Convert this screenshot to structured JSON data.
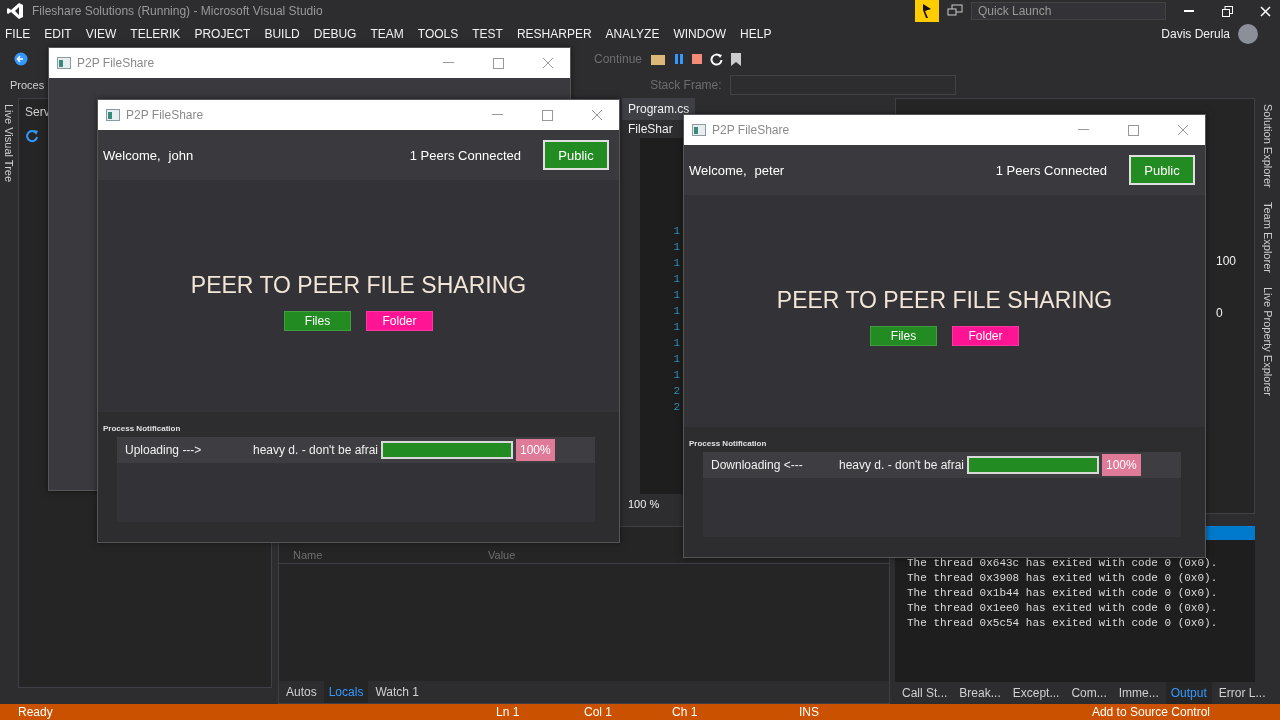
{
  "app": {
    "title": "Fileshare Solutions (Running) - Microsoft Visual Studio",
    "user": "Davis Derula",
    "quick_launch": {
      "placeholder": "Quick Launch"
    }
  },
  "menu": [
    "FILE",
    "EDIT",
    "VIEW",
    "TELERIK",
    "PROJECT",
    "BUILD",
    "DEBUG",
    "TEAM",
    "TOOLS",
    "TEST",
    "RESHARPER",
    "ANALYZE",
    "WINDOW",
    "HELP"
  ],
  "toolbar": {
    "continue": "Continue",
    "process_label": "Proces",
    "stack_frame_label": "Stack Frame:"
  },
  "left_rail": {
    "tabs": [
      "Live Visual Tree"
    ]
  },
  "left_panel": {
    "title": "Serv"
  },
  "editor": {
    "tab": "Program.cs",
    "file": "FileShar",
    "line_numbers": [
      "1",
      "1",
      "1",
      "1",
      "1",
      "1",
      "1",
      "1",
      "1",
      "1",
      "2",
      "2"
    ],
    "zoom": "100 %"
  },
  "locals": {
    "columns": [
      "Name",
      "Value"
    ],
    "tabs": [
      {
        "label": "Autos",
        "selected": false
      },
      {
        "label": "Locals",
        "selected": true
      },
      {
        "label": "Watch 1",
        "selected": false
      }
    ]
  },
  "diagnostics": {
    "values": [
      "100",
      "0"
    ]
  },
  "right_rail": {
    "tabs": [
      "Solution Explorer",
      "Team Explorer",
      "Live Property Explorer"
    ]
  },
  "output": {
    "lines": [
      "The thread 0x643c has exited with code 0 (0x0).",
      "The thread 0x3908 has exited with code 0 (0x0).",
      "The thread 0x1b44 has exited with code 0 (0x0).",
      "The thread 0x1ee0 has exited with code 0 (0x0).",
      "The thread 0x5c54 has exited with code 0 (0x0)."
    ],
    "tabs": [
      {
        "label": "Call St...",
        "selected": false
      },
      {
        "label": "Break...",
        "selected": false
      },
      {
        "label": "Except...",
        "selected": false
      },
      {
        "label": "Com...",
        "selected": false
      },
      {
        "label": "Imme...",
        "selected": false
      },
      {
        "label": "Output",
        "selected": true
      },
      {
        "label": "Error L...",
        "selected": false
      }
    ]
  },
  "status_bar": {
    "ready": "Ready",
    "ln": "Ln 1",
    "col": "Col 1",
    "ch": "Ch 1",
    "mode": "INS",
    "source_control": "Add to Source Control"
  },
  "windows": [
    {
      "kind": "background",
      "title": "P2P FileShare"
    },
    {
      "kind": "full",
      "title": "P2P FileShare",
      "welcome": "Welcome,",
      "user": "john",
      "peers": "1 Peers Connected",
      "visibility": "Public",
      "heading": "PEER TO PEER FILE SHARING",
      "buttons": [
        "Files",
        "Folder"
      ],
      "notification_label": "Process Notification",
      "transfers": [
        {
          "direction": "Uploading --->",
          "file": "heavy d. - don't be afrai",
          "level": 1,
          "percent": "100%"
        }
      ]
    },
    {
      "kind": "full",
      "title": "P2P FileShare",
      "welcome": "Welcome,",
      "user": "peter",
      "peers": "1 Peers Connected",
      "visibility": "Public",
      "heading": "PEER TO PEER FILE SHARING",
      "buttons": [
        "Files",
        "Folder"
      ],
      "notification_label": "Process Notification",
      "transfers": [
        {
          "direction": "Downloading <---",
          "file": "heavy d. - don't be afrai",
          "level": 1,
          "percent": "100%"
        }
      ]
    }
  ]
}
